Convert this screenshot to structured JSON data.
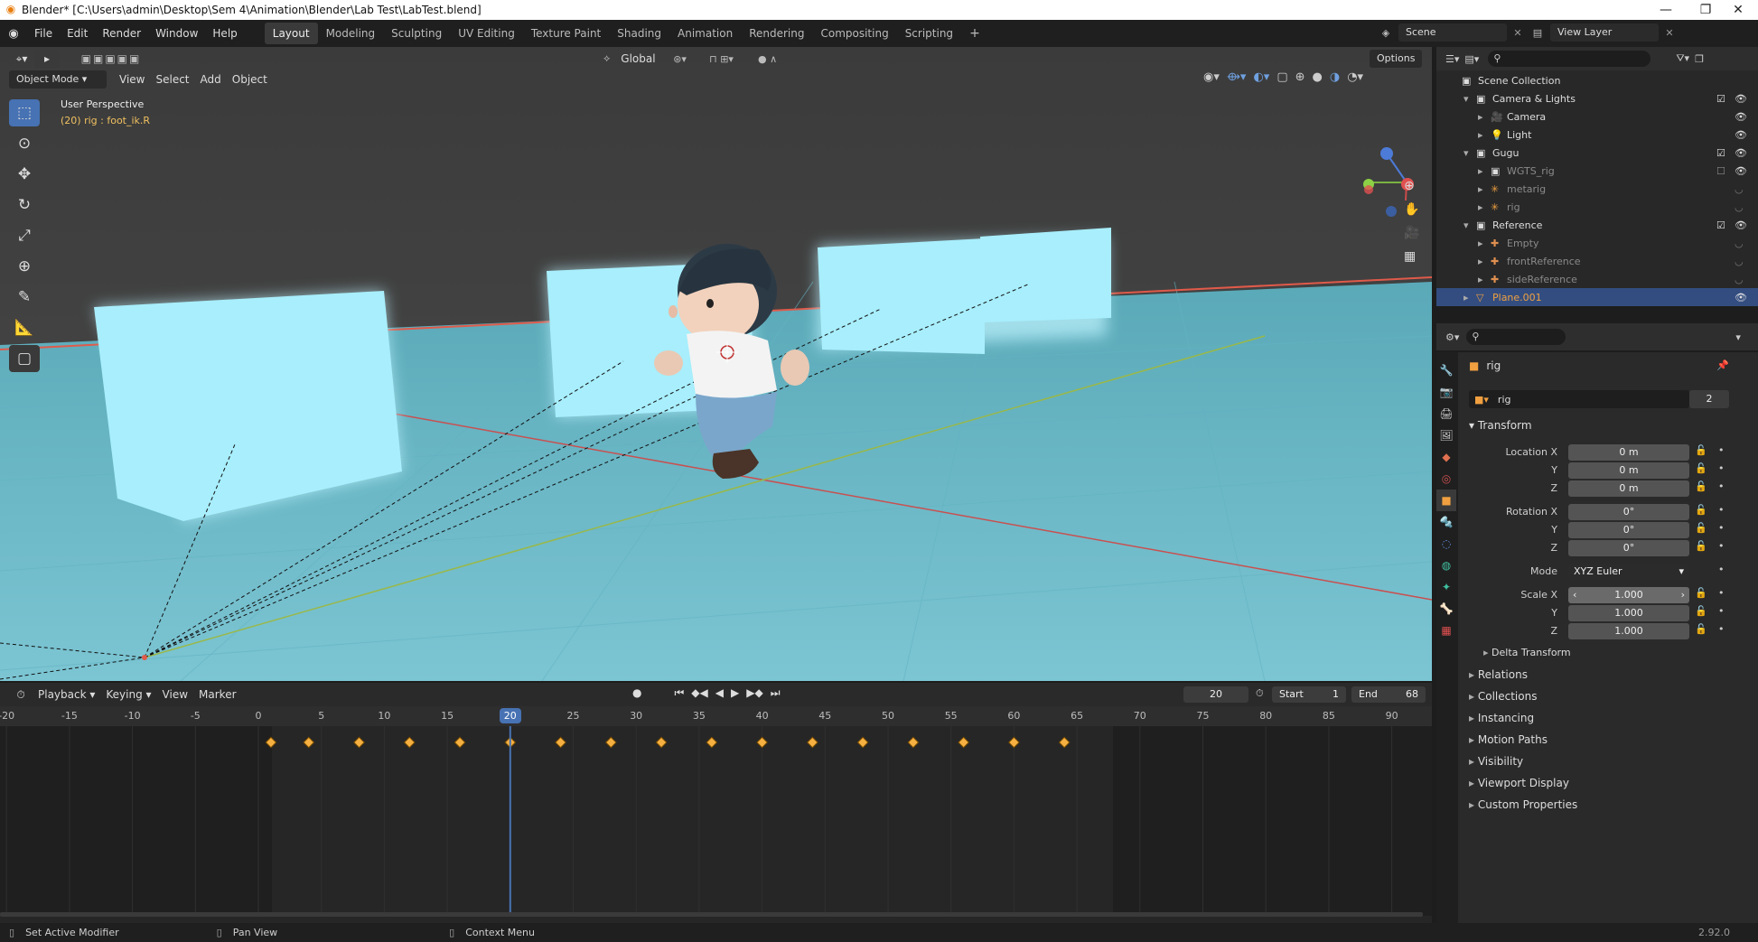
{
  "window": {
    "title": "Blender* [C:\\Users\\admin\\Desktop\\Sem 4\\Animation\\Blender\\Lab Test\\LabTest.blend]"
  },
  "menu": [
    "File",
    "Edit",
    "Render",
    "Window",
    "Help"
  ],
  "workspaces": [
    "Layout",
    "Modeling",
    "Sculpting",
    "UV Editing",
    "Texture Paint",
    "Shading",
    "Animation",
    "Rendering",
    "Compositing",
    "Scripting"
  ],
  "active_workspace": "Layout",
  "scene": {
    "name": "Scene",
    "view_layer": "View Layer"
  },
  "viewport": {
    "mode": "Object Mode",
    "menus": [
      "View",
      "Select",
      "Add",
      "Object"
    ],
    "orientation": "Global",
    "options_label": "Options",
    "overlay_title": "User Perspective",
    "overlay_sub": "(20) rig : foot_ik.R"
  },
  "timeline": {
    "menus": [
      "Playback",
      "Keying",
      "View",
      "Marker"
    ],
    "current_frame": "20",
    "start_label": "Start",
    "start": "1",
    "end_label": "End",
    "end": "68",
    "ruler": [
      "-20",
      "-15",
      "-10",
      "-5",
      "0",
      "5",
      "10",
      "15",
      "20",
      "25",
      "30",
      "35",
      "40",
      "45",
      "50",
      "55",
      "60",
      "65",
      "70",
      "75",
      "80",
      "85",
      "90"
    ],
    "keyframes": [
      1,
      4,
      8,
      12,
      16,
      20,
      24,
      28,
      32,
      36,
      40,
      44,
      48,
      52,
      56,
      60,
      64
    ]
  },
  "outliner": {
    "rows": [
      {
        "label": "Scene Collection",
        "indent": 0,
        "type": "collection"
      },
      {
        "label": "Camera & Lights",
        "indent": 1,
        "type": "collection"
      },
      {
        "label": "Camera",
        "indent": 2,
        "type": "camera"
      },
      {
        "label": "Light",
        "indent": 2,
        "type": "light"
      },
      {
        "label": "Gugu",
        "indent": 1,
        "type": "collection"
      },
      {
        "label": "WGTS_rig",
        "indent": 2,
        "type": "collection",
        "dim": true
      },
      {
        "label": "metarig",
        "indent": 2,
        "type": "armature",
        "dim": true
      },
      {
        "label": "rig",
        "indent": 2,
        "type": "armature",
        "dim": true
      },
      {
        "label": "Reference",
        "indent": 1,
        "type": "collection"
      },
      {
        "label": "Empty",
        "indent": 2,
        "type": "empty",
        "dim": true
      },
      {
        "label": "frontReference",
        "indent": 2,
        "type": "empty",
        "dim": true
      },
      {
        "label": "sideReference",
        "indent": 2,
        "type": "empty",
        "dim": true
      },
      {
        "label": "Plane.001",
        "indent": 1,
        "type": "mesh",
        "selected": true
      }
    ]
  },
  "properties": {
    "object_name": "rig",
    "data_name": "rig",
    "users": "2",
    "transform_label": "Transform",
    "location": {
      "label": "Location X",
      "x": "0 m",
      "y": "0 m",
      "z": "0 m"
    },
    "rotation": {
      "label": "Rotation X",
      "x": "0°",
      "y": "0°",
      "z": "0°"
    },
    "mode_label": "Mode",
    "mode": "XYZ Euler",
    "scale": {
      "label": "Scale X",
      "x": "1.000",
      "y": "1.000",
      "z": "1.000"
    },
    "axis_y": "Y",
    "axis_z": "Z",
    "sections": [
      "Delta Transform",
      "Relations",
      "Collections",
      "Instancing",
      "Motion Paths",
      "Visibility",
      "Viewport Display",
      "Custom Properties"
    ]
  },
  "status": {
    "left": "Set Active Modifier",
    "middle": "Pan View",
    "right": "Context Menu",
    "version": "2.92.0"
  },
  "colors": {
    "accent": "#4772b3",
    "keyframe": "#f5b041",
    "playhead": "#4772b3",
    "selected_row": "#334d80",
    "floor": "#6fbdcc",
    "cube": "#a8eefc"
  }
}
